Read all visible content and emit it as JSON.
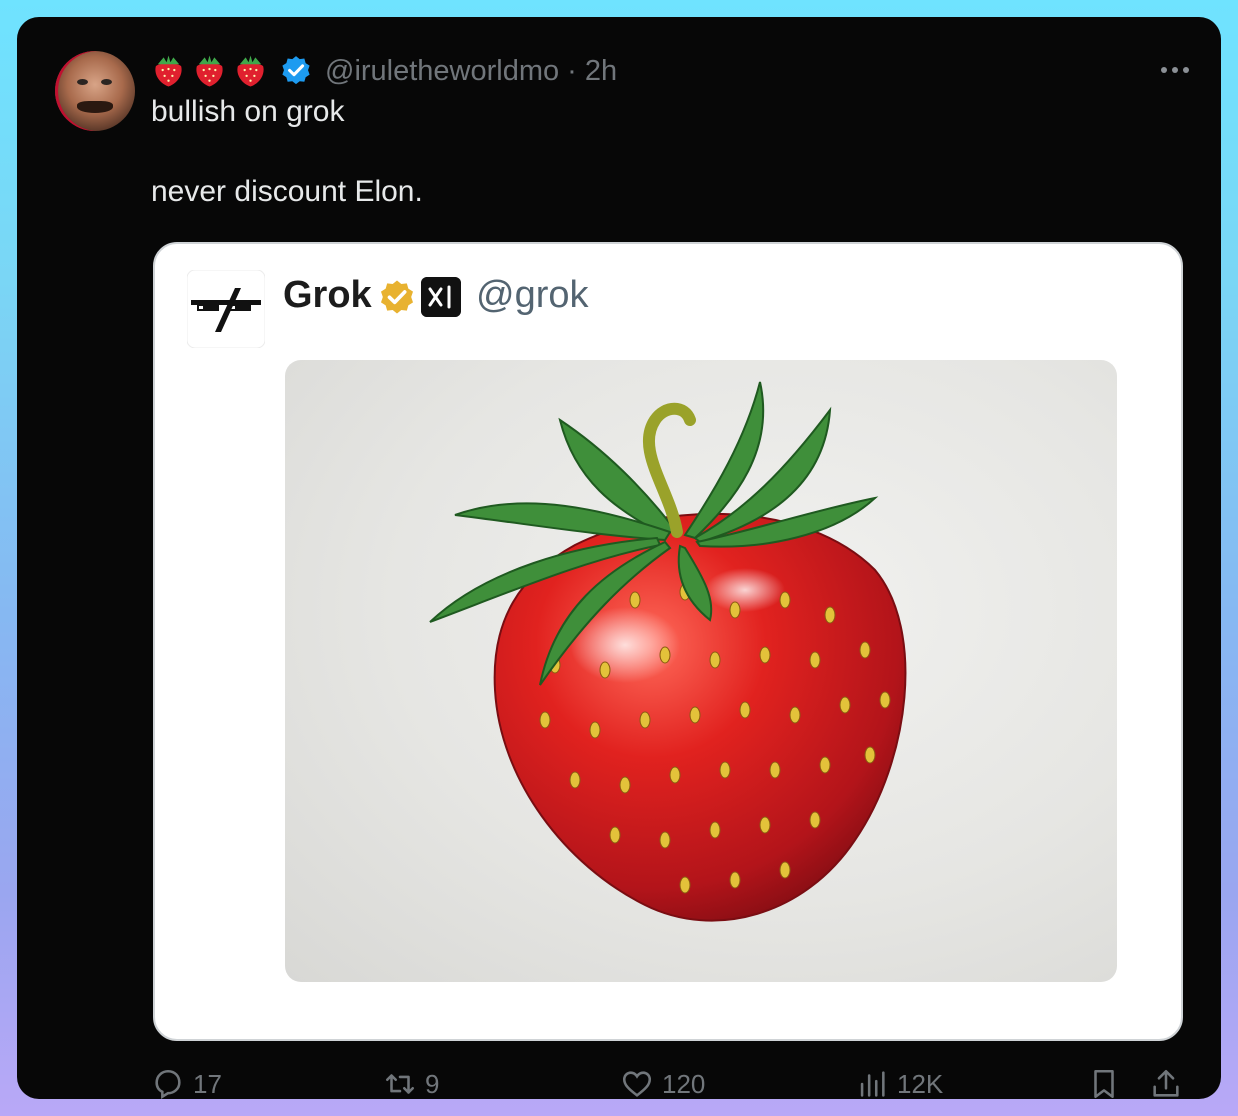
{
  "tweet": {
    "emojis": [
      "strawberry",
      "strawberry",
      "strawberry"
    ],
    "handle": "@iruletheworldmo",
    "separator": "·",
    "time": "2h",
    "line1": "bullish on grok",
    "line2": "never discount Elon."
  },
  "quoted": {
    "name": "Grok",
    "handle": "@grok",
    "image_subject": "strawberry-drawing"
  },
  "actions": {
    "replies": "17",
    "reposts": "9",
    "likes": "120",
    "views": "12K"
  },
  "colors": {
    "verified_blue": "#1d9bf0",
    "verified_gold": "#e8b230",
    "muted_text": "#71767b",
    "card_bg": "#ffffff"
  }
}
